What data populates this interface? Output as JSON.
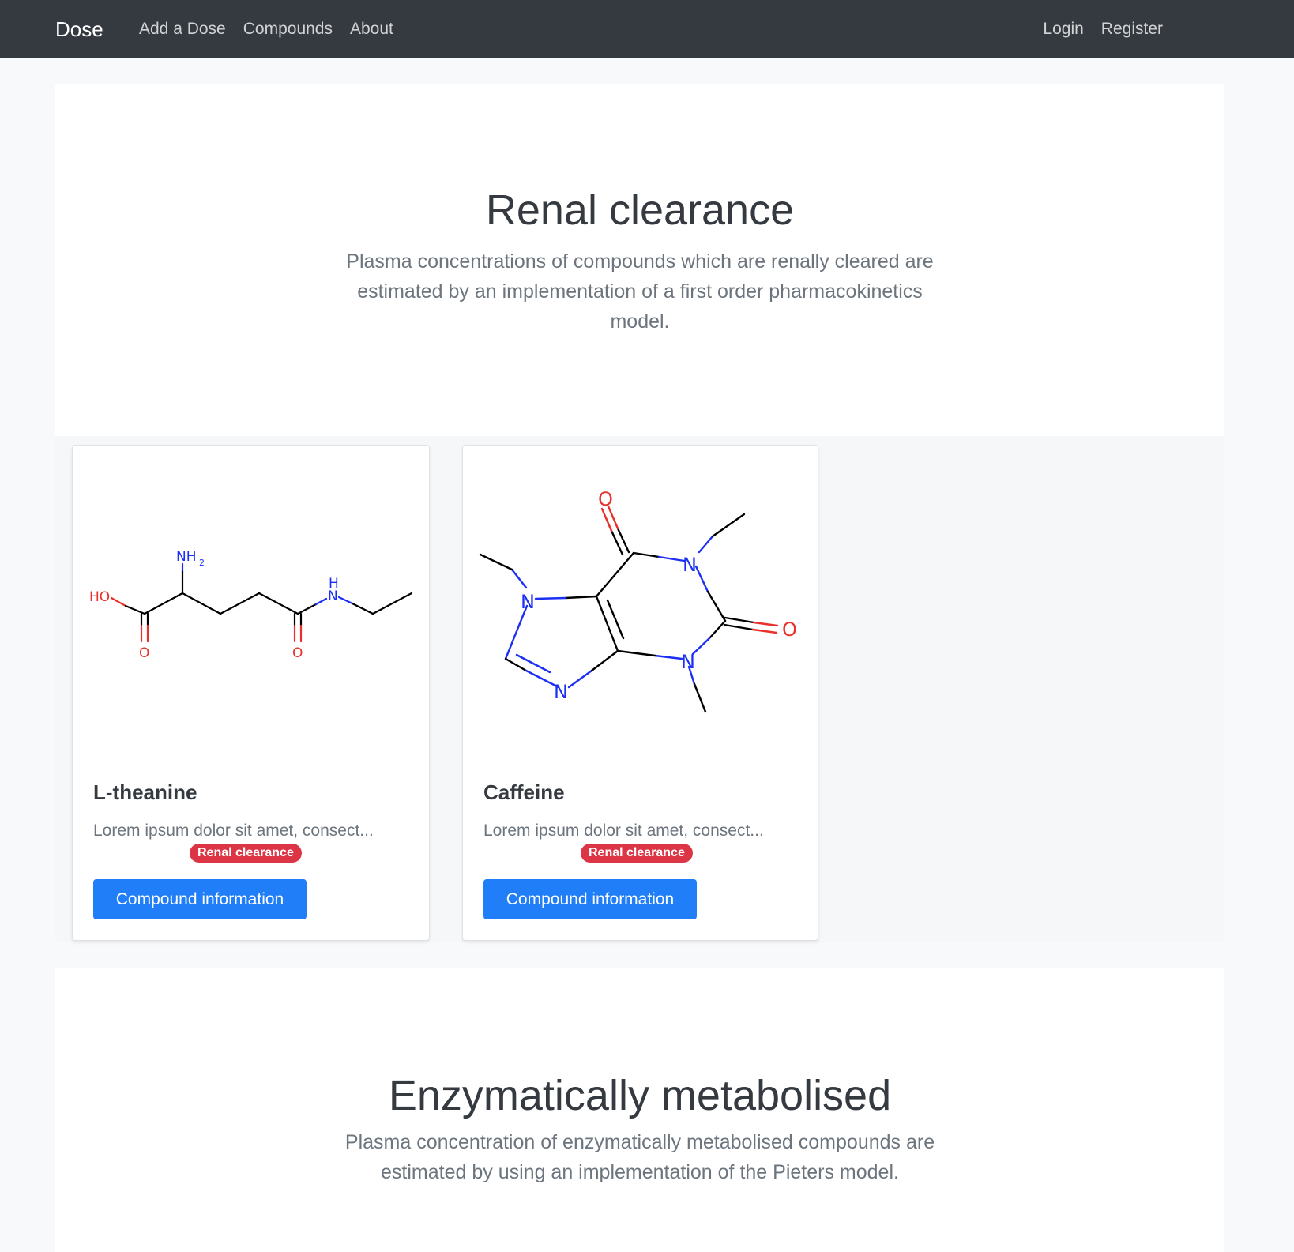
{
  "navbar": {
    "brand": "Dose",
    "left_links": [
      "Add a Dose",
      "Compounds",
      "About"
    ],
    "right_links": [
      "Login",
      "Register"
    ]
  },
  "sections": [
    {
      "title": "Renal clearance",
      "description": "Plasma concentrations of compounds which are renally cleared are estimated by an implementation of a first order pharmacokinetics model."
    },
    {
      "title": "Enzymatically metabolised",
      "description": "Plasma concentration of enzymatically metabolised compounds are estimated by using an implementation of the Pieters model."
    }
  ],
  "cards": [
    {
      "title": "L-theanine",
      "text": "Lorem ipsum dolor sit amet, consect...",
      "badge": "Renal clearance",
      "button": "Compound information",
      "structure": {
        "HO": "HO",
        "O": "O",
        "NH2": "NH",
        "NH2_sub": "2",
        "H": "H",
        "N": "N"
      }
    },
    {
      "title": "Caffeine",
      "text": "Lorem ipsum dolor sit amet, consect...",
      "badge": "Renal clearance",
      "button": "Compound information",
      "structure": {
        "N": "N",
        "O": "O"
      }
    }
  ],
  "colors": {
    "navbar": "#343a40",
    "primary": "#1f7ef8",
    "badge": "#dc3545",
    "oxygen": "#e8312a",
    "nitrogen": "#1c2ff5"
  }
}
